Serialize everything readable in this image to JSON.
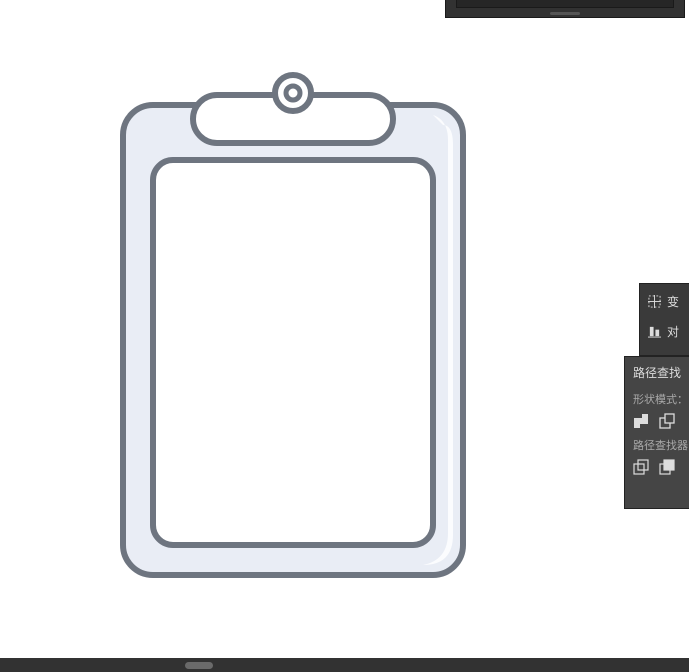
{
  "top_fragment": {},
  "transform_panel": {
    "rows": [
      {
        "label": "变"
      },
      {
        "label": "对"
      }
    ]
  },
  "pathfinder_panel": {
    "title": "路径查找",
    "shape_modes_label": "形状模式：",
    "pathfinder_label": "路径查找器"
  },
  "canvas": {
    "artwork": "clipboard-illustration"
  }
}
